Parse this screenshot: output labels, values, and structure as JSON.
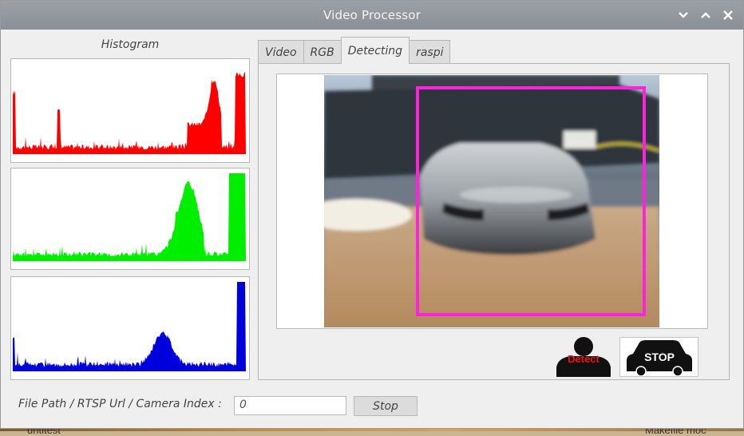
{
  "window": {
    "title": "Video Processor"
  },
  "histogram": {
    "title": "Histogram",
    "channels": [
      {
        "name": "red",
        "color": "#ff0000"
      },
      {
        "name": "green",
        "color": "#00ee00"
      },
      {
        "name": "blue",
        "color": "#0000dd"
      }
    ]
  },
  "tabs": [
    {
      "label": "Video",
      "active": false
    },
    {
      "label": "RGB",
      "active": false
    },
    {
      "label": "Detecting",
      "active": true
    },
    {
      "label": "raspi",
      "active": false
    }
  ],
  "detection": {
    "box_color": "#ff22dd"
  },
  "buttons": {
    "detect_label": "Detect",
    "stop_sign_label": "STOP"
  },
  "source": {
    "label": "File Path / RTSP Url / Camera Index :",
    "value": "0",
    "stop_label": "Stop"
  },
  "desktop": {
    "left_text": "untitest",
    "right_text": "Makefile   moc"
  }
}
